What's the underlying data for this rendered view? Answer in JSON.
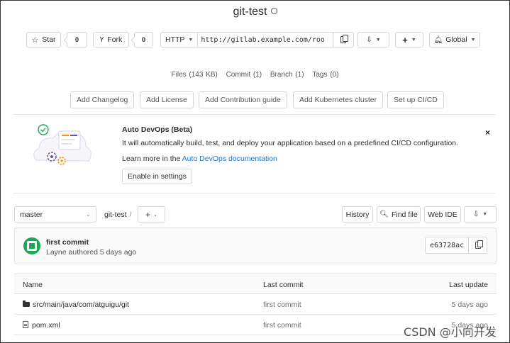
{
  "project": {
    "title": "git-test"
  },
  "actions": {
    "star_label": "Star",
    "star_count": "0",
    "fork_label": "Fork",
    "fork_count": "0",
    "protocol": "HTTP",
    "clone_url": "http://gitlab.example.com/roo",
    "notification": "Global"
  },
  "stats": {
    "files": "Files (143 KB)",
    "commit": "Commit (1)",
    "branch": "Branch (1)",
    "tags": "Tags (0)"
  },
  "shortcuts": [
    "Add Changelog",
    "Add License",
    "Add Contribution guide",
    "Add Kubernetes cluster",
    "Set up CI/CD"
  ],
  "devops": {
    "title": "Auto DevOps (Beta)",
    "description": "It will automatically build, test, and deploy your application based on a predefined CI/CD configuration.",
    "learn_prefix": "Learn more in the",
    "learn_link": "Auto DevOps documentation",
    "enable_button": "Enable in settings",
    "close": "×"
  },
  "repo": {
    "branch": "master",
    "path": "git-test",
    "history": "History",
    "find_file": "Find file",
    "web_ide": "Web IDE"
  },
  "last_commit": {
    "title": "first commit",
    "meta": "Layne authored 5 days ago",
    "sha": "e63728ac"
  },
  "table": {
    "headers": {
      "name": "Name",
      "last_commit": "Last commit",
      "last_update": "Last update"
    },
    "rows": [
      {
        "name": "src/main/java/com/atguigu/git",
        "type": "folder",
        "commit": "first commit",
        "updated": "5 days ago"
      },
      {
        "name": "pom.xml",
        "type": "file",
        "commit": "first commit",
        "updated": "5 days ago"
      }
    ]
  },
  "watermark": "CSDN @小向开发",
  "colors": {
    "link": "#1f78d1",
    "avatar": "#1aaa55",
    "border": "#d6d6d6"
  }
}
